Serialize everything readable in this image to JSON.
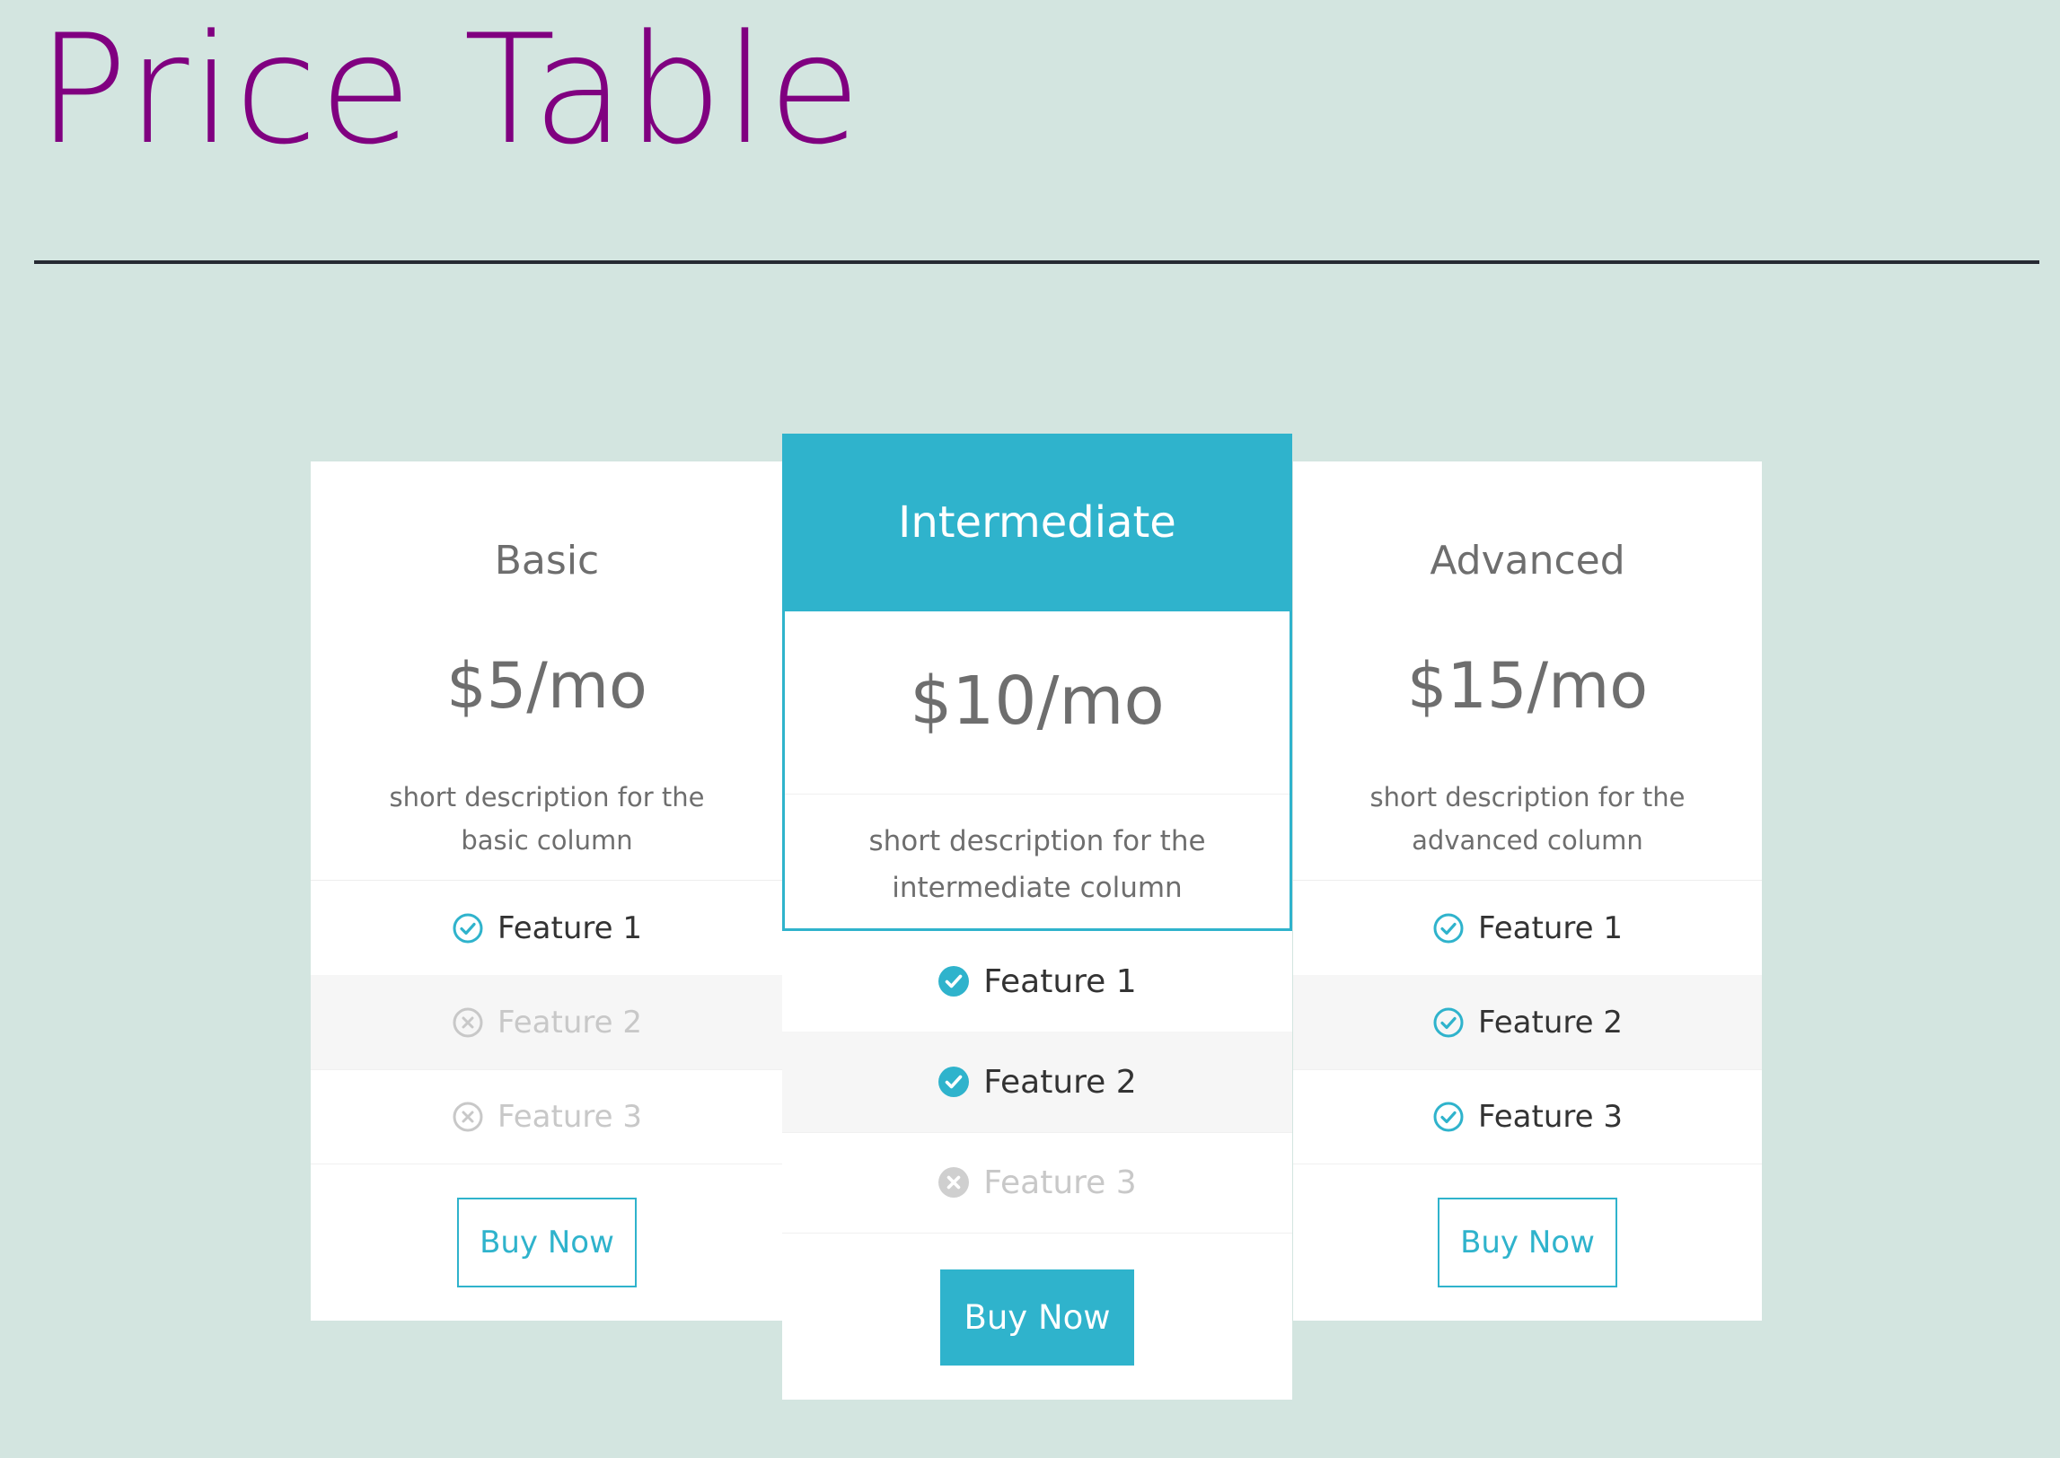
{
  "page": {
    "title": "Price Table"
  },
  "colors": {
    "background": "#d3e5e0",
    "title": "#800080",
    "accent": "#2fb3cc",
    "divider": "#262a33",
    "text": "#6e6e6e",
    "disabled": "#c8c8c8"
  },
  "plans": [
    {
      "name": "Basic",
      "price": "$5/mo",
      "description": "short description for the basic column",
      "features": [
        {
          "label": "Feature 1",
          "included": true,
          "icon": "check-circle-outline-icon"
        },
        {
          "label": "Feature 2",
          "included": false,
          "icon": "x-circle-outline-icon"
        },
        {
          "label": "Feature 3",
          "included": false,
          "icon": "x-circle-outline-icon"
        }
      ],
      "button": "Buy Now"
    },
    {
      "name": "Intermediate",
      "price": "$10/mo",
      "description": "short description for the intermediate column",
      "features": [
        {
          "label": "Feature 1",
          "included": true,
          "icon": "check-circle-filled-icon"
        },
        {
          "label": "Feature 2",
          "included": true,
          "icon": "check-circle-filled-icon"
        },
        {
          "label": "Feature 3",
          "included": false,
          "icon": "x-circle-filled-icon"
        }
      ],
      "button": "Buy Now",
      "featured": true
    },
    {
      "name": "Advanced",
      "price": "$15/mo",
      "description": "short description for the advanced column",
      "features": [
        {
          "label": "Feature 1",
          "included": true,
          "icon": "check-circle-outline-icon"
        },
        {
          "label": "Feature 2",
          "included": true,
          "icon": "check-circle-outline-icon"
        },
        {
          "label": "Feature 3",
          "included": true,
          "icon": "check-circle-outline-icon"
        }
      ],
      "button": "Buy Now"
    }
  ]
}
